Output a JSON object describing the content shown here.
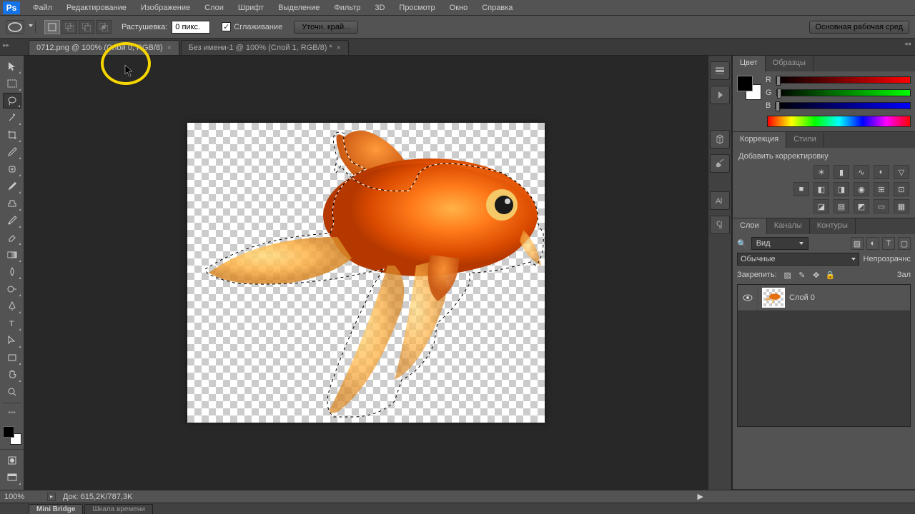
{
  "app": {
    "logo": "Ps"
  },
  "menu": {
    "file": "Файл",
    "edit": "Редактирование",
    "image": "Изображение",
    "layer": "Слои",
    "type": "Шрифт",
    "select": "Выделение",
    "filter": "Фильтр",
    "threed": "3D",
    "view": "Просмотр",
    "window": "Окно",
    "help": "Справка"
  },
  "options": {
    "feather_label": "Растушевка:",
    "feather_value": "0 пикс.",
    "antialias_label": "Сглаживание",
    "refine_edge": "Уточн. край...",
    "workspace": "Основная рабочая сред"
  },
  "tabs": {
    "tab1": "0712.png @ 100% (Слой 0, RGB/8)",
    "tab2": "Без имени-1 @ 100% (Слой 1, RGB/8) *"
  },
  "panels": {
    "color_tab": "Цвет",
    "swatches_tab": "Образцы",
    "r_label": "R",
    "g_label": "G",
    "b_label": "B",
    "adjustments_tab": "Коррекция",
    "styles_tab": "Стили",
    "add_adjustment": "Добавить корректировку",
    "layers_tab": "Слои",
    "channels_tab": "Каналы",
    "paths_tab": "Контуры",
    "kind_label": "Вид",
    "blend_mode": "Обычные",
    "opacity_label": "Непрозрачнс",
    "lock_label": "Закрепить:",
    "fill_label": "Зал",
    "layer0_name": "Слой 0"
  },
  "status": {
    "zoom": "100%",
    "doc_info": "Док: 615,2K/787,3K"
  },
  "bottom_tabs": {
    "minibridge": "Mini Bridge",
    "timeline": "Шкала времени"
  }
}
